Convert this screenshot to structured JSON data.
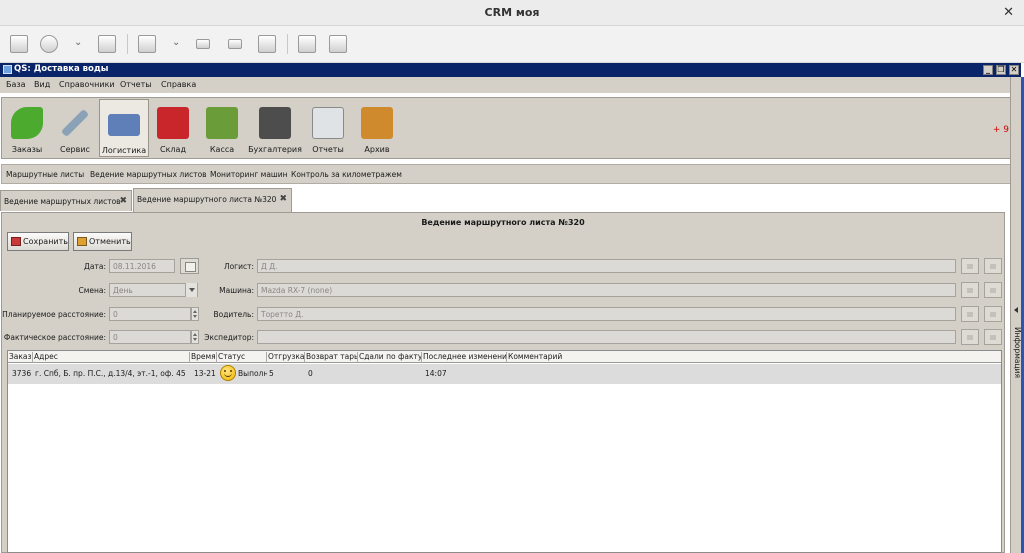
{
  "host": {
    "title": "CRM моя",
    "close_glyph": "✕",
    "toolbar_icons": [
      "window-icon",
      "move-icon",
      "chevron-down-icon",
      "copy-window-icon",
      "zoom-icon",
      "chevron-down-icon",
      "keyboard-icon",
      "ratio-icon",
      "settings-icon",
      "download-icon",
      "plug-icon"
    ]
  },
  "app": {
    "title": "QS: Доставка воды",
    "minimize": "_",
    "restore": "❐",
    "close": "✕"
  },
  "menu": [
    "База",
    "Вид",
    "Справочники",
    "Отчеты",
    "Справка"
  ],
  "modules": [
    {
      "label": "Заказы",
      "icon": "phone-icon",
      "color": "#4caa2e"
    },
    {
      "label": "Сервис",
      "icon": "tools-icon",
      "color": "#8aa1b8"
    },
    {
      "label": "Логистика",
      "icon": "truck-icon",
      "color": "#5f7fb8"
    },
    {
      "label": "Склад",
      "icon": "warehouse-icon",
      "color": "#c8262b"
    },
    {
      "label": "Касса",
      "icon": "cash-icon",
      "color": "#6a9d3a"
    },
    {
      "label": "Бухгалтерия",
      "icon": "calculator-icon",
      "color": "#4d4d4d"
    },
    {
      "label": "Отчеты",
      "icon": "report-icon",
      "color": "#dfe3e6"
    },
    {
      "label": "Архив",
      "icon": "archive-icon",
      "color": "#d08a2e"
    }
  ],
  "badge": "+ 9",
  "subnav": [
    "Маршрутные листы",
    "Ведение маршрутных листов",
    "Мониторинг машин",
    "Контроль за километражем"
  ],
  "tabs": [
    {
      "label": "Ведение маршрутных листов",
      "close": "✖"
    },
    {
      "label": "Ведение маршрутного листа №320",
      "close": "✖"
    }
  ],
  "doc": {
    "title": "Ведение маршрутного листа №320",
    "save": "Сохранить",
    "cancel": "Отменить"
  },
  "form": {
    "date_label": "Дата:",
    "date_value": "08.11.2016",
    "shift_label": "Смена:",
    "shift_value": "День",
    "planned_label": "Планируемое расстояние:",
    "planned_value": "0",
    "actual_label": "Фактическое расстояние:",
    "actual_value": "0",
    "logist_label": "Логист:",
    "logist_value": "Д Д.",
    "car_label": "Машина:",
    "car_value": "Mazda RX-7 (none)",
    "driver_label": "Водитель:",
    "driver_value": "Торетто Д.",
    "forwarder_label": "Экспедитор:",
    "forwarder_value": ""
  },
  "table": {
    "columns": [
      "Заказ",
      "Адрес",
      "Время",
      "Статус",
      "Отгрузка",
      "Возврат тары",
      "Сдали по факту",
      "Последнее изменение",
      "Комментарий"
    ],
    "rows": [
      {
        "order": "3736",
        "address": "г. Спб, Б. пр. П.С., д.13/4, эт.-1, оф. 45",
        "time": "13-21",
        "status": "Выполн",
        "shipped": "5",
        "returned": "0",
        "fact": "",
        "changed": "14:07",
        "comment": ""
      }
    ]
  },
  "side_panel": "Информация"
}
